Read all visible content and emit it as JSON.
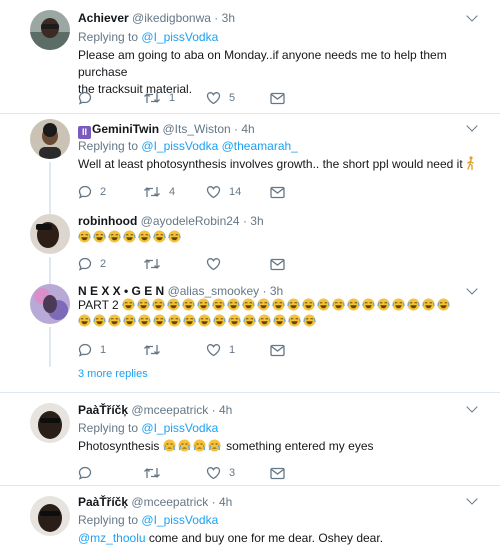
{
  "tweets": [
    {
      "name": "Achiever",
      "handle": "@ikedigbonwa",
      "time": "3h",
      "replying_label": "Replying to",
      "replying_to": "@I_pissVodka",
      "text_lines": [
        "Please am going to aba on Monday..if anyone needs me to help them purchase",
        "the tracksuit material."
      ],
      "reply_count": "",
      "retweet_count": "1",
      "like_count": "5"
    },
    {
      "name": "GeminiTwin",
      "badge": "II",
      "handle": "@Its_Wiston",
      "time": "4h",
      "replying_label": "Replying to",
      "replying_to": "@I_pissVodka @theamarah_",
      "text": "Well at least photosynthesis involves growth.. the short ppl would need it",
      "reply_count": "2",
      "retweet_count": "4",
      "like_count": "14"
    },
    {
      "name": "robinhood",
      "handle": "@ayodeleRobin24",
      "time": "3h",
      "emoji_count": 7,
      "reply_count": "2",
      "retweet_count": "",
      "like_count": ""
    },
    {
      "name": "N E X X • G E N",
      "handle": "@alias_smookey",
      "time": "3h",
      "text": "PART 2",
      "emoji_line1_count": 22,
      "emoji_line2_count": 16,
      "reply_count": "1",
      "retweet_count": "",
      "like_count": "1",
      "more_replies": "3 more replies"
    },
    {
      "name": "PaàŤříčķ",
      "handle": "@mceepatrick",
      "time": "4h",
      "replying_label": "Replying to",
      "replying_to": "@I_pissVodka",
      "text_before": "Photosynthesis",
      "text_after": "something entered my eyes",
      "reply_count": "",
      "retweet_count": "",
      "like_count": "3"
    },
    {
      "name": "PaàŤříčķ",
      "handle": "@mceepatrick",
      "time": "4h",
      "replying_label": "Replying to",
      "replying_to": "@I_pissVodka",
      "mention": "@mz_thoolu",
      "text": " come and buy one for me dear. Oshey dear."
    }
  ],
  "separator_dot": "·",
  "colors": {
    "accent": "#1da1f2",
    "muted": "#657786",
    "text": "#14171a",
    "border": "#e1e8ed"
  }
}
